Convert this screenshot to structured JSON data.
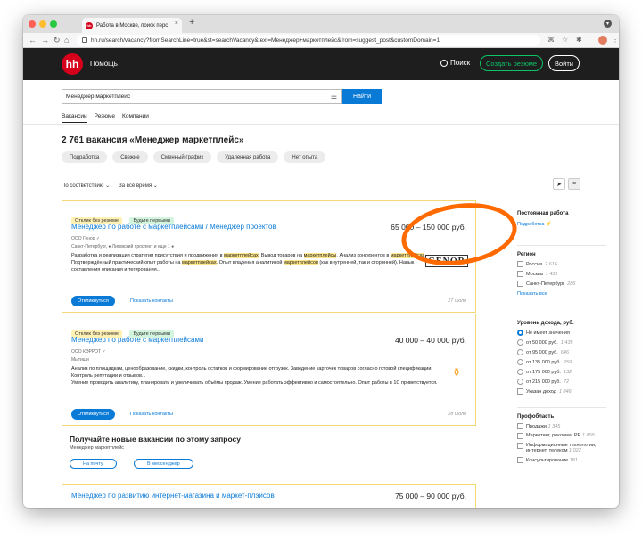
{
  "browser": {
    "tab_title": "Работа в Москве, поиск перс",
    "tab_close": "×",
    "new_tab": "+",
    "url": "hh.ru/search/vacancy?fromSearchLine=true&st=searchVacancy&text=Менеджер+маркетплейс&from=suggest_post&customDomain=1",
    "traffic_colors": [
      "#ff5f57",
      "#febc2e",
      "#28c840"
    ]
  },
  "header": {
    "logo": "hh",
    "help": "Помощь",
    "search": "Поиск",
    "create_resume": "Создать резюме",
    "login": "Войти"
  },
  "search": {
    "query": "Менеджер маркетплейс",
    "find_button": "Найти"
  },
  "tabs": [
    "Вакансии",
    "Резюме",
    "Компании"
  ],
  "results": {
    "heading": "2 761 вакансия «Менеджер маркетплейс»",
    "chips": [
      "Подработка",
      "Свежие",
      "Сменный график",
      "Удаленная работа",
      "Нет опыта"
    ],
    "sort": "По соответствию",
    "period": "За всё время"
  },
  "vacancies": [
    {
      "badges": [
        "Отклик без резюме",
        "Будьте первыми"
      ],
      "title": "Менеджер по работе с маркетплейсами / Менеджер проектов",
      "salary": "65 000 – 150 000 руб.",
      "company": "ООО Генор",
      "location": "Санкт-Петербург, ● Лиговский проспект и еще 1 ●",
      "logo_text": "GENOR",
      "desc_1": "Разработка и реализация стратегии присутствия и продвижения в",
      "hl_1": "маркетплейсах",
      "desc_2": ". Вывод товаров на",
      "hl_2": "маркетплейсы",
      "desc_3": ". Анализ конкурентов в",
      "hl_3": "маркетплейсах",
      "desc_4": "Подтверждённый практический опыт работы на",
      "hl_4": "маркетплейсах",
      "desc_5": ". Опыт владения аналитикой",
      "hl_5": "маркетплейсов",
      "desc_6": "(как внутренней, так и сторонней). Навык составления описания и тегирования...",
      "respond": "Откликнуться",
      "contacts": "Показать контакты",
      "date": "27 июля"
    },
    {
      "badges": [
        "Отклик без резюме",
        "Будьте первыми"
      ],
      "title": "Менеджер по работе с маркетплейсами",
      "salary": "40 000 – 40 000 руб.",
      "company": "ООО КЭРРОТ",
      "location": "Мытищи",
      "desc_1": "Анализ по площадкам, ценообразование, скидки, контроль остатков и формирование отгрузок. Заведение карточек товаров согласно готовой спецификации. Контроль репутации и отзывов...",
      "desc_2": "Умение проводить аналитику, планировать и увеличивать объёмы продаж. Умение работать эффективно и самостоятельно. Опыт работы в 1С приветствуется.",
      "respond": "Откликнуться",
      "contacts": "Показать контакты",
      "date": "28 июля"
    },
    {
      "title": "Менеджер по развитию интернет-магазина и маркет-плэйсов",
      "salary": "75 000 – 90 000 руб."
    }
  ],
  "subscribe": {
    "title": "Получайте новые вакансии по этому запросу",
    "query": "Менеджер маркетплейс",
    "by_mail": "На почту",
    "by_messenger": "В мессенджер"
  },
  "sidebar": {
    "employment_title": "Постоянная работа",
    "employment_link": "Подработка",
    "region_title": "Регион",
    "regions": [
      {
        "label": "Россия",
        "count": "2 616"
      },
      {
        "label": "Москва",
        "count": "1 431"
      },
      {
        "label": "Санкт-Петербург",
        "count": "286"
      }
    ],
    "show_all": "Показать все",
    "income_title": "Уровень дохода, руб.",
    "incomes": [
      {
        "label": "Не имеет значения",
        "count": ""
      },
      {
        "label": "от 50 000 руб.",
        "count": "1 435"
      },
      {
        "label": "от 95 000 руб.",
        "count": "646"
      },
      {
        "label": "от 135 000 руб.",
        "count": "259"
      },
      {
        "label": "от 175 000 руб.",
        "count": "132"
      },
      {
        "label": "от 215 000 руб.",
        "count": "72"
      }
    ],
    "income_specified": "Указан доход",
    "income_specified_count": "1 846",
    "prof_title": "Профобласть",
    "profs": [
      {
        "label": "Продажи",
        "count": "1 345"
      },
      {
        "label": "Маркетинг, реклама, PR",
        "count": "1 055"
      },
      {
        "label": "Информационные технологии, интернет, телеком",
        "count": "1 022"
      },
      {
        "label": "Консультирование",
        "count": "181"
      }
    ]
  }
}
